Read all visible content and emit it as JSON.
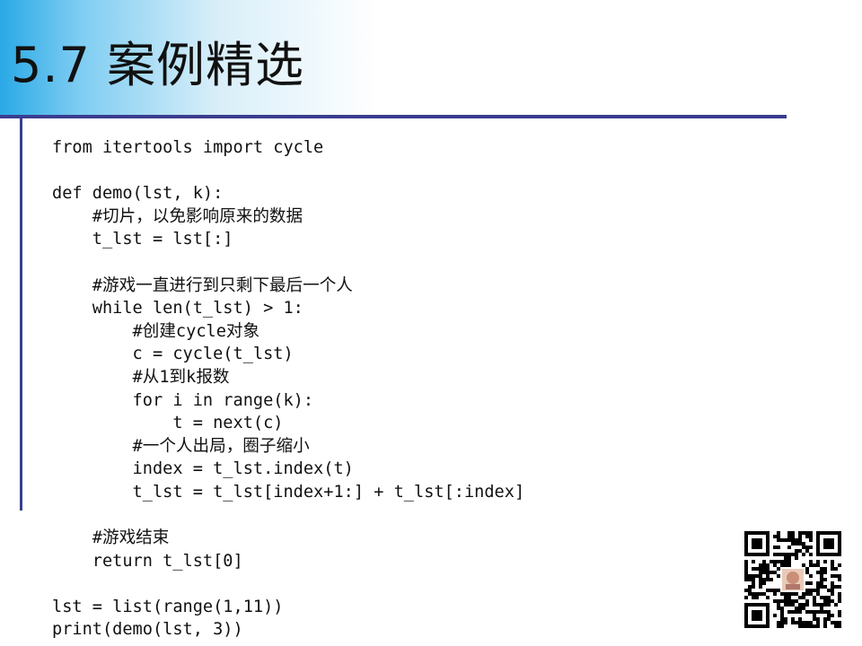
{
  "slide": {
    "title": "5.7 案例精选"
  },
  "code": {
    "lines": [
      "from itertools import cycle",
      "",
      "def demo(lst, k):",
      "    #切片，以免影响原来的数据",
      "    t_lst = lst[:]",
      "",
      "    #游戏一直进行到只剩下最后一个人",
      "    while len(t_lst) > 1:",
      "        #创建cycle对象",
      "        c = cycle(t_lst)",
      "        #从1到k报数",
      "        for i in range(k):",
      "            t = next(c)",
      "        #一个人出局，圈子缩小",
      "        index = t_lst.index(t)",
      "        t_lst = t_lst[index+1:] + t_lst[:index]",
      "",
      "    #游戏结束",
      "    return t_lst[0]",
      "",
      "lst = list(range(1,11))",
      "print(demo(lst, 3))"
    ]
  },
  "qr_code": {
    "icon": "qr-code-icon"
  },
  "colors": {
    "header_accent": "#2aa9e6",
    "rule": "#3a3d8f",
    "text": "#111111"
  }
}
